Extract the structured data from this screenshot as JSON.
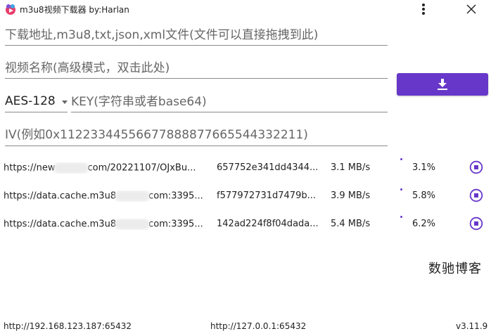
{
  "window": {
    "title": "m3u8视频下载器 by:Harlan",
    "icons": {
      "app": "app-icon",
      "menu": "more-vertical-icon",
      "close": "close-icon"
    }
  },
  "form": {
    "url_placeholder": "下载地址,m3u8,txt,json,xml文件(文件可以直接拖拽到此)",
    "name_placeholder": "视频名称(高级模式，双击此处)",
    "encryption_selected": "AES-128",
    "key_placeholder": "KEY(字符串或者base64)",
    "iv_placeholder": "IV(例如0x11223344556677888877665544332211)",
    "download_icon": "download-icon",
    "accent_color": "#6737c9"
  },
  "tasks": [
    {
      "url_prefix": "https://new",
      "url_suffix": "com/20221107/OJxBu...",
      "hash": "657752e341dd4344...",
      "speed": "3.1 MB/s",
      "percent": "3.1%",
      "progress": 0.031
    },
    {
      "url_prefix": "https://data.cache.m3u8",
      "url_suffix": "com:3395...",
      "hash": "f577972731d7479b...",
      "speed": "3.9 MB/s",
      "percent": "5.8%",
      "progress": 0.058
    },
    {
      "url_prefix": "https://data.cache.m3u8",
      "url_suffix": "com:3395...",
      "hash": "142ad224f8f04dada...",
      "speed": "5.4 MB/s",
      "percent": "6.2%",
      "progress": 0.062
    }
  ],
  "watermark": "数驰博客",
  "footer": {
    "left": "http://192.168.123.187:65432",
    "middle": "http://127.0.0.1:65432",
    "version": "v3.11.9"
  }
}
